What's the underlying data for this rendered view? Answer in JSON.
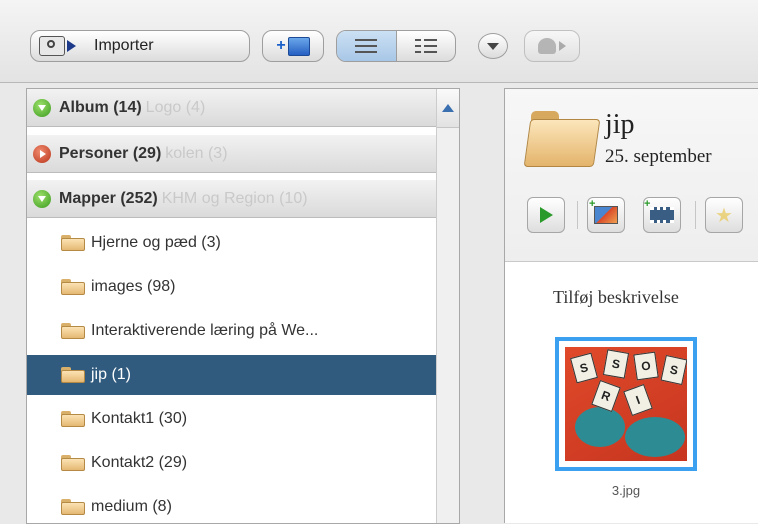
{
  "toolbar": {
    "import_label": "Importer",
    "icons": [
      "camera-icon",
      "add-album-icon",
      "list-view-icon",
      "detail-view-icon",
      "chevron-down-icon",
      "share-icon"
    ]
  },
  "sidebar": {
    "sections": [
      {
        "label": "Album (14)",
        "hidden_text": "Logo (4)",
        "state": "expanded"
      },
      {
        "label": "Personer (29)",
        "hidden_text": "kolen (3)",
        "state": "collapsed"
      },
      {
        "label": "Mapper (252)",
        "hidden_text": "KHM og Region (10)",
        "state": "expanded"
      }
    ],
    "folders": [
      {
        "label": "Hjerne og pæd (3)",
        "selected": false
      },
      {
        "label": "images (98)",
        "selected": false
      },
      {
        "label": "Interaktiverende læring på We...",
        "selected": false
      },
      {
        "label": "jip (1)",
        "selected": true
      },
      {
        "label": "Kontakt1 (30)",
        "selected": false
      },
      {
        "label": "Kontakt2 (29)",
        "selected": false
      },
      {
        "label": "medium (8)",
        "selected": false
      }
    ]
  },
  "album": {
    "title": "jip",
    "date": "25. september",
    "description_placeholder": "Tilføj beskrivelse",
    "photos": [
      {
        "filename": "3.jpg",
        "selected": true,
        "card_letters": [
          "S",
          "S",
          "O",
          "S",
          "R",
          "I"
        ]
      }
    ]
  },
  "colors": {
    "selected_row": "#315b7e",
    "thumbnail_border": "#3aa0ef",
    "toggle_green": "#3b9a1f",
    "toggle_red": "#b8341a"
  }
}
